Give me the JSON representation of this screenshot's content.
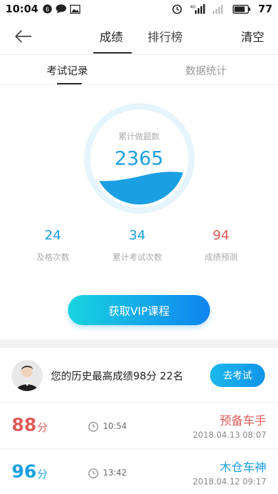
{
  "status_bar": {
    "time": "10:04",
    "battery": "77",
    "network": "4G"
  },
  "nav": {
    "tabs": [
      "成绩",
      "排行榜"
    ],
    "active_tab": 0,
    "clear_label": "清空"
  },
  "sub_tabs": [
    "考试记录",
    "数据统计"
  ],
  "gauge": {
    "label": "累计做题数",
    "value": "2365"
  },
  "stats": [
    {
      "value": "24",
      "label": "及格次数",
      "color": "#1b9fe0"
    },
    {
      "value": "34",
      "label": "累计考试次数",
      "color": "#1b9fe0"
    },
    {
      "value": "94",
      "label": "成绩预测",
      "color": "#e05a5a"
    }
  ],
  "vip_button": "获取VIP课程",
  "history": {
    "text": "您的历史最高成绩98分  22名",
    "button": "去考试"
  },
  "records": [
    {
      "score": "88",
      "unit": "分",
      "time": "10:54",
      "title": "预备车手",
      "date": "2018.04.13   08:07",
      "color": "#e05a5a"
    },
    {
      "score": "96",
      "unit": "分",
      "time": "13:42",
      "title": "木仓车神",
      "date": "2018.04.12   09:17",
      "color": "#1b9fe0"
    }
  ],
  "colors": {
    "accent_blue": "#1b9fe0",
    "accent_red": "#e05a5a"
  }
}
